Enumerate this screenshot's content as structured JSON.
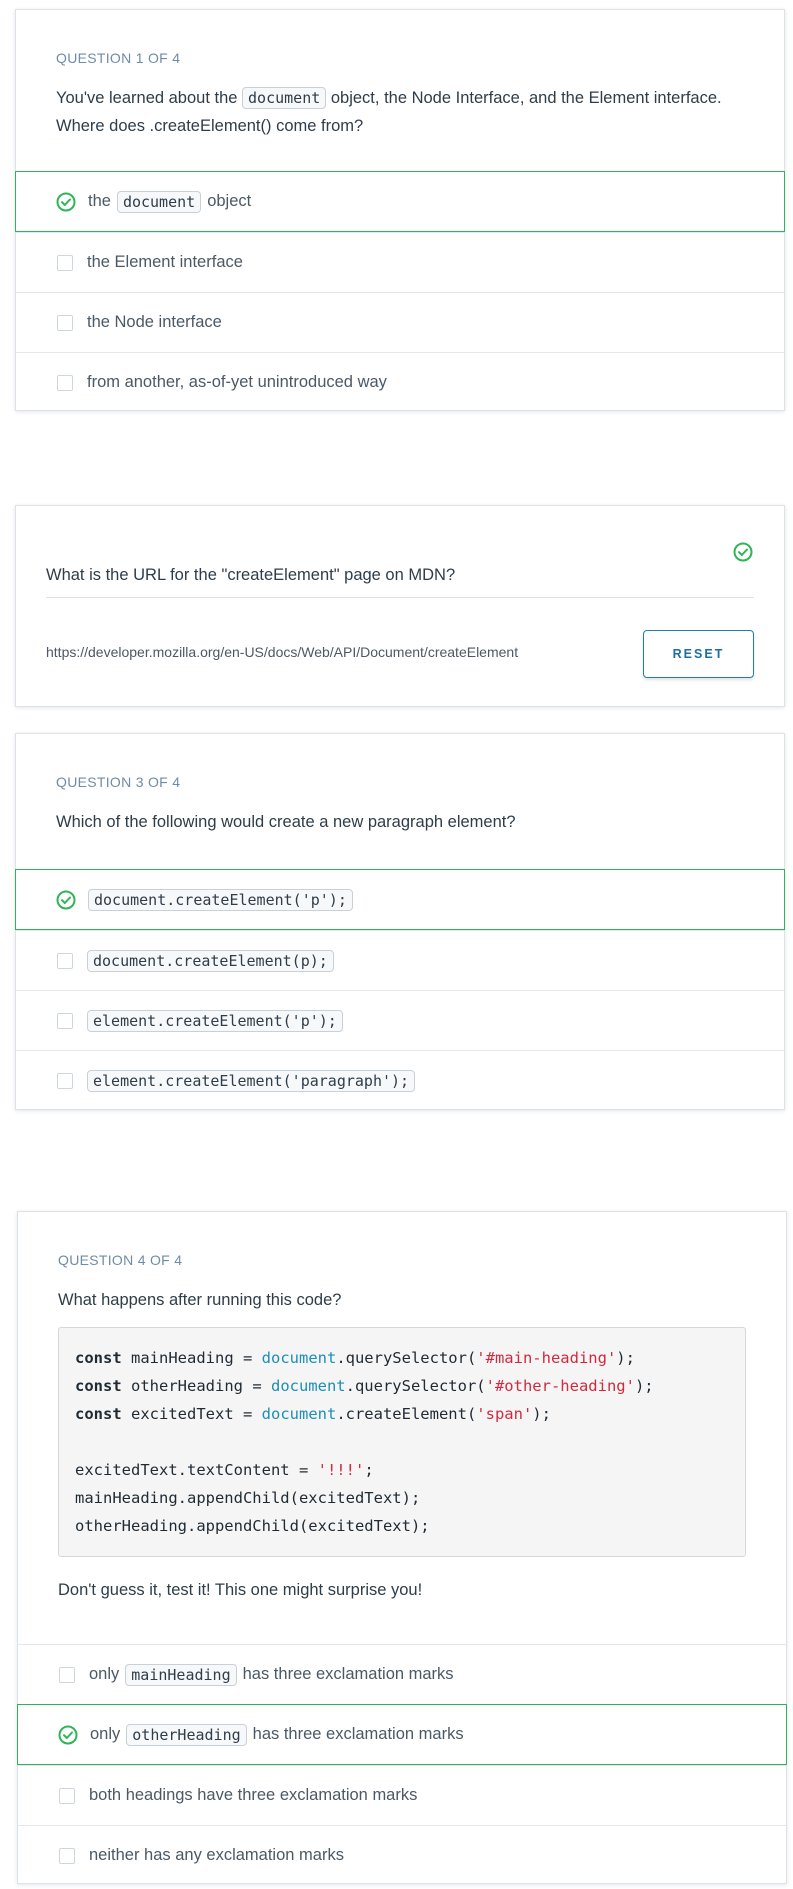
{
  "colors": {
    "correct": "#2fb457",
    "accent": "#1e7fb6",
    "string": "#d2293e",
    "object": "#1b8fb6"
  },
  "q1": {
    "number": "QUESTION 1 OF 4",
    "prompt_before": "You've learned about the ",
    "prompt_code": "document",
    "prompt_after": " object, the Node Interface, and the Element interface. Where does .createElement() come from?",
    "answers": [
      {
        "before": "the ",
        "code": "document",
        "after": " object",
        "correct": true
      },
      {
        "text": "the Element interface",
        "correct": false
      },
      {
        "text": "the Node interface",
        "correct": false
      },
      {
        "text": "from another, as-of-yet unintroduced way",
        "correct": false
      }
    ]
  },
  "q2": {
    "prompt": "What is the URL for the \"createElement\" page on MDN?",
    "answer": "https://developer.mozilla.org/en-US/docs/Web/API/Document/createElement",
    "reset_label": "RESET",
    "status_icon": "check-circle-icon"
  },
  "q3": {
    "number": "QUESTION 3 OF 4",
    "prompt": "Which of the following would create a new paragraph element?",
    "answers": [
      {
        "code": "document.createElement('p');",
        "correct": true
      },
      {
        "code": "document.createElement(p);",
        "correct": false
      },
      {
        "code": "element.createElement('p');",
        "correct": false
      },
      {
        "code": "element.createElement('paragraph');",
        "correct": false
      }
    ]
  },
  "q4": {
    "number": "QUESTION 4 OF 4",
    "prompt": "What happens after running this code?",
    "code": {
      "kw_const": "const",
      "line1_var": " mainHeading = ",
      "line1_obj": "document",
      "line1_call": ".querySelector(",
      "line1_str": "'#main-heading'",
      "line1_end": ");",
      "line2_var": " otherHeading = ",
      "line2_obj": "document",
      "line2_call": ".querySelector(",
      "line2_str": "'#other-heading'",
      "line2_end": ");",
      "line3_var": " excitedText = ",
      "line3_obj": "document",
      "line3_call": ".createElement(",
      "line3_str": "'span'",
      "line3_end": ");",
      "line5_start": "excitedText.textContent = ",
      "line5_str": "'!!!'",
      "line5_end": ";",
      "line6": "mainHeading.appendChild(excitedText);",
      "line7": "otherHeading.appendChild(excitedText);"
    },
    "hint": "Don't guess it, test it! This one might surprise you!",
    "answers": [
      {
        "before": "only ",
        "code": "mainHeading",
        "after": " has three exclamation marks",
        "correct": false
      },
      {
        "before": "only ",
        "code": "otherHeading",
        "after": " has three exclamation marks",
        "correct": true
      },
      {
        "text": "both headings have three exclamation marks",
        "correct": false
      },
      {
        "text": "neither has any exclamation marks",
        "correct": false
      }
    ]
  }
}
